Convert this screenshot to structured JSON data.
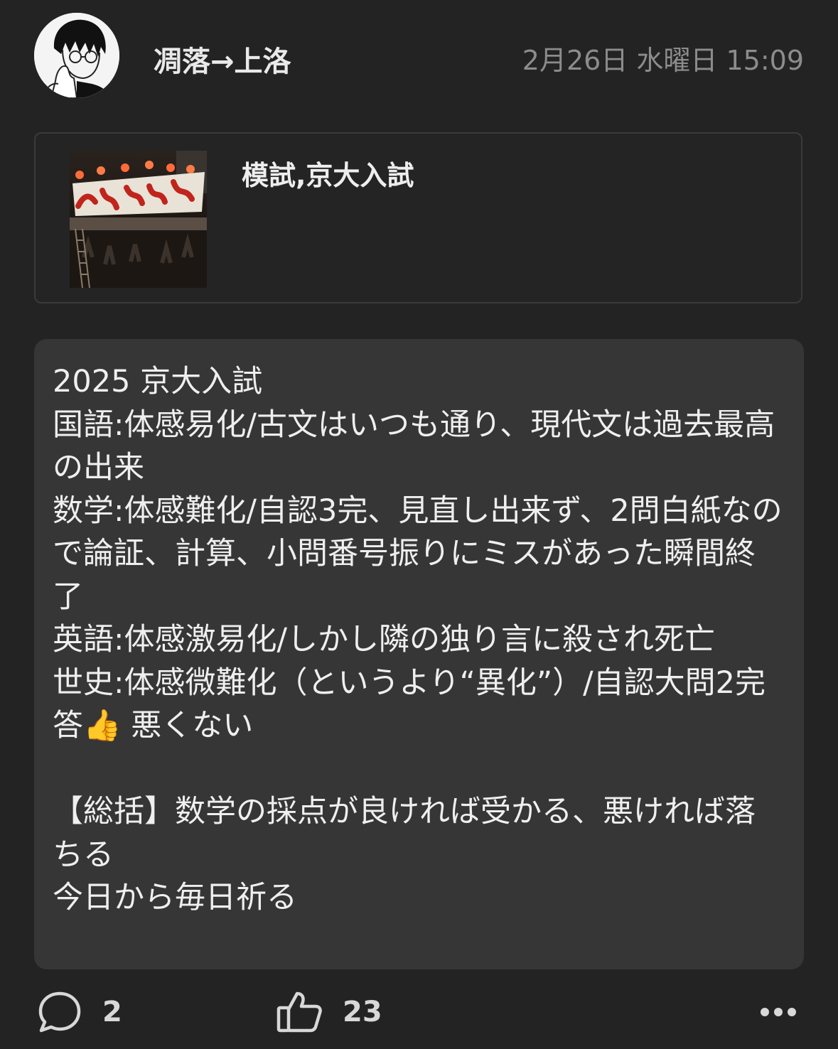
{
  "author": {
    "name": "凋落→上洛",
    "avatar_icon": "manga-portrait-avatar"
  },
  "timestamp": "2月26日 水曜日 15:09",
  "link_card": {
    "title": "模試,京大入試",
    "thumbnail_icon": "festival-banner-photo"
  },
  "post": {
    "lines": [
      "2025 京大入試",
      "国語:体感易化/古文はいつも通り、現代文は過去最高の出来",
      "数学:体感難化/自認3完、見直し出来ず、2問白紙なので論証、計算、小問番号振りにミスがあった瞬間終了",
      "英語:体感激易化/しかし隣の独り言に殺され死亡",
      "世史:体感微難化（というより“異化”）/自認大問2完答👍 悪くない",
      "",
      "【総括】数学の採点が良ければ受かる、悪ければ落ちる",
      "今日から毎日祈る"
    ]
  },
  "actions": {
    "comment_icon": "comment-bubble-icon",
    "comment_count": "2",
    "like_icon": "thumbs-up-icon",
    "like_count": "23",
    "more_icon": "more-dots-icon"
  },
  "colors": {
    "background": "#232323",
    "body_panel": "#363636",
    "card_border": "#3a3a3a",
    "text": "#efefef",
    "muted": "#8c8c8c"
  }
}
